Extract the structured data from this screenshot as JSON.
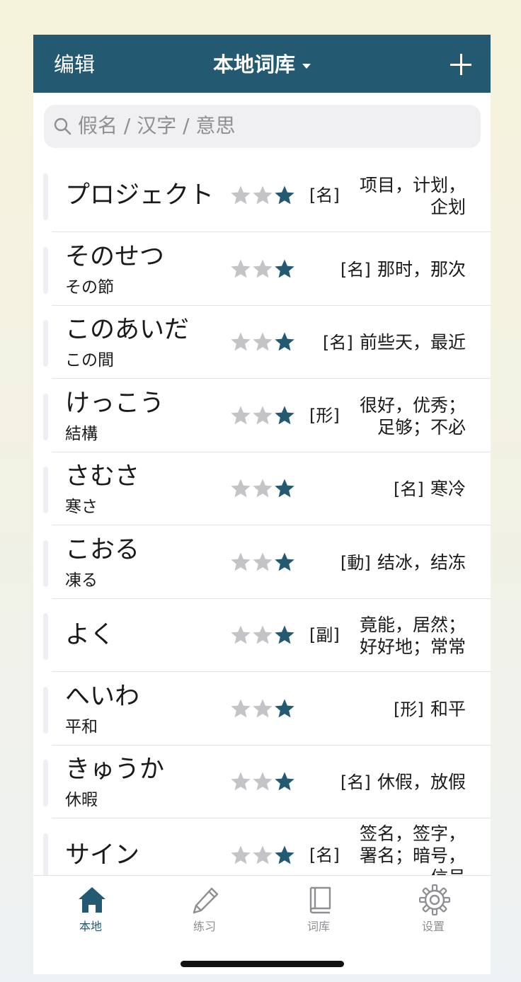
{
  "header": {
    "edit_label": "编辑",
    "title": "本地词库",
    "add_icon": "plus-icon"
  },
  "search": {
    "placeholder": "假名 / 汉字 / 意思",
    "icon": "search-icon"
  },
  "colors": {
    "primary": "#235a72",
    "star_filled": "#235a72",
    "star_empty": "#c4c4c8",
    "inactive": "#8e8e93"
  },
  "words": [
    {
      "kana": "プロジェクト",
      "kanji": "",
      "stars_filled": 1,
      "pos": "[名]",
      "meaning_lines": [
        "项目，计划，",
        "企划"
      ]
    },
    {
      "kana": "そのせつ",
      "kanji": "その節",
      "stars_filled": 1,
      "pos": "[名]",
      "meaning_lines": [
        "那时，那次"
      ]
    },
    {
      "kana": "このあいだ",
      "kanji": "この間",
      "stars_filled": 1,
      "pos": "[名]",
      "meaning_lines": [
        "前些天，最近"
      ]
    },
    {
      "kana": "けっこう",
      "kanji": "結構",
      "stars_filled": 1,
      "pos": "[形]",
      "meaning_lines": [
        "很好，优秀；",
        "足够；不必"
      ]
    },
    {
      "kana": "さむさ",
      "kanji": "寒さ",
      "stars_filled": 1,
      "pos": "[名]",
      "meaning_lines": [
        "寒冷"
      ]
    },
    {
      "kana": "こおる",
      "kanji": "凍る",
      "stars_filled": 1,
      "pos": "[動]",
      "meaning_lines": [
        "结冰，结冻"
      ]
    },
    {
      "kana": "よく",
      "kanji": "",
      "stars_filled": 1,
      "pos": "[副]",
      "meaning_lines": [
        "竟能，居然；",
        "好好地；常常"
      ]
    },
    {
      "kana": "へいわ",
      "kanji": "平和",
      "stars_filled": 1,
      "pos": "[形]",
      "meaning_lines": [
        "和平"
      ]
    },
    {
      "kana": "きゅうか",
      "kanji": "休暇",
      "stars_filled": 1,
      "pos": "[名]",
      "meaning_lines": [
        "休假，放假"
      ]
    },
    {
      "kana": "サイン",
      "kanji": "",
      "stars_filled": 1,
      "pos": "[名]",
      "meaning_lines": [
        "签名，签字，",
        "署名；暗号，",
        "信号"
      ]
    }
  ],
  "tabs": [
    {
      "label": "本地",
      "icon": "home-icon",
      "active": true
    },
    {
      "label": "练习",
      "icon": "pencil-icon",
      "active": false
    },
    {
      "label": "词库",
      "icon": "book-icon",
      "active": false
    },
    {
      "label": "设置",
      "icon": "gear-icon",
      "active": false
    }
  ]
}
